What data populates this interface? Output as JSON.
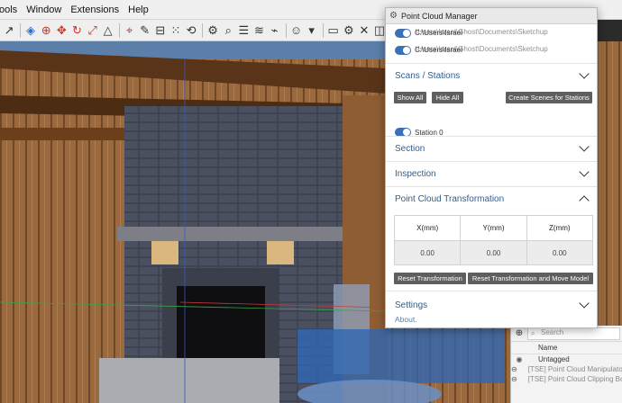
{
  "menubar": {
    "items": [
      "ools",
      "Window",
      "Extensions",
      "Help"
    ]
  },
  "toolbar": {
    "icons": [
      "select-icon",
      "orbit-icon",
      "zoom-icon",
      "move-icon",
      "rotate-icon",
      "scale-icon",
      "warning-icon",
      "pin-icon",
      "pen-icon",
      "ruler-icon",
      "gear-icon",
      "search-icon",
      "walk-icon",
      "layers-icon",
      "folder-icon",
      "close-icon"
    ]
  },
  "dialog": {
    "title": "Point Cloud Manager",
    "paths": [
      {
        "a": "C:\\Users\\Israel",
        "b": "\\Users\\Israel\\Ghost\\Documents\\Sketchup"
      },
      {
        "a": "C:\\Users\\Israel",
        "b": "\\Users\\Israel\\Ghost\\Documents\\Sketchup"
      }
    ],
    "sections": {
      "scans": "Scans / Stations",
      "section": "Section",
      "inspection": "Inspection",
      "transform": "Point Cloud Transformation",
      "settings": "Settings"
    },
    "buttons": {
      "show_all": "Show All",
      "hide_all": "Hide All",
      "create_scenes": "Create Scenes for Stations",
      "reset_transform": "Reset Transformation",
      "reset_move": "Reset Transformation and Move Model"
    },
    "station": "Station 0",
    "transform_table": {
      "headers": [
        "X(mm)",
        "Y(mm)",
        "Z(mm)"
      ],
      "values": [
        "0.00",
        "0.00",
        "0.00"
      ]
    },
    "about": "About."
  },
  "layers": {
    "search_placeholder": "Search",
    "column_name": "Name",
    "rows": [
      {
        "label": "Untagged",
        "dim": false
      },
      {
        "label": "[TSE] Point Cloud Manipulator",
        "dim": true
      },
      {
        "label": "[TSE] Point Cloud Clipping Box",
        "dim": true
      }
    ]
  },
  "colors": {
    "accent": "#3b6fb6",
    "section_header": "#2f5e8f",
    "button_bg": "#5f5f5f"
  }
}
